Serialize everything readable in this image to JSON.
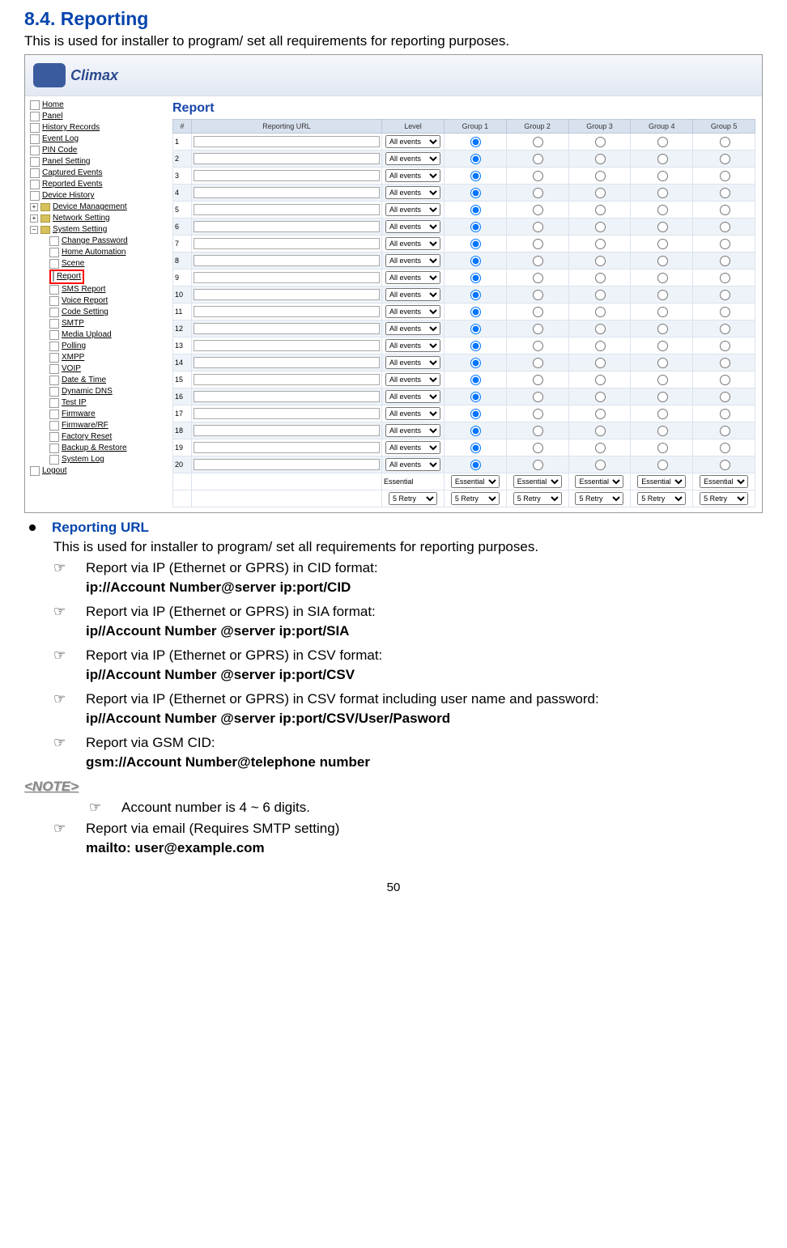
{
  "section_title": "8.4. Reporting",
  "intro": "This is used for installer to program/ set all requirements for reporting purposes.",
  "logo": "Climax",
  "sidebar": {
    "root": [
      "Home",
      "Panel",
      "History Records",
      "Event Log",
      "PIN Code",
      "Panel Setting",
      "Captured Events",
      "Reported Events",
      "Device History"
    ],
    "exp1": "Device Management",
    "exp2": "Network Setting",
    "exp3": "System Setting",
    "children": [
      "Change Password",
      "Home Automation",
      "Scene",
      "Report",
      "SMS Report",
      "Voice Report",
      "Code Setting",
      "SMTP",
      "Media Upload",
      "Polling",
      "XMPP",
      "VOIP",
      "Date & Time",
      "Dynamic DNS",
      "Test IP",
      "Firmware",
      "Firmware/RF",
      "Factory Reset",
      "Backup & Restore",
      "System Log"
    ],
    "logout": "Logout"
  },
  "panel": {
    "title": "Report",
    "headers": [
      "#",
      "Reporting URL",
      "Level",
      "Group 1",
      "Group 2",
      "Group 3",
      "Group 4",
      "Group 5"
    ],
    "level_option": "All events",
    "rows": 20,
    "footer_sel1": "Essential",
    "footer_sel2": "5 Retry"
  },
  "content": {
    "bullet_label": "Reporting URL",
    "sub_intro": "This is used for installer to program/ set all requirements for reporting purposes.",
    "p1": "Report via IP (Ethernet or GPRS) in CID format:",
    "b1": "ip://Account Number@server ip:port/CID",
    "p2": "Report via IP (Ethernet or GPRS) in SIA format:",
    "b2": "ip//Account Number @server ip:port/SIA",
    "p3": "Report via IP (Ethernet or GPRS) in CSV format:",
    "b3": "ip//Account Number @server ip:port/CSV",
    "p4": "Report via IP (Ethernet or GPRS) in CSV format including user name and password:",
    "b4": "ip//Account Number @server ip:port/CSV/User/Pasword",
    "p5": "Report via GSM CID:",
    "b5": "gsm://Account Number@telephone number",
    "note": "<NOTE>",
    "note_body": "Account number is 4 ~ 6 digits.",
    "p6": "Report via email (Requires SMTP setting)",
    "b6": "mailto: user@example.com"
  },
  "page_num": "50"
}
